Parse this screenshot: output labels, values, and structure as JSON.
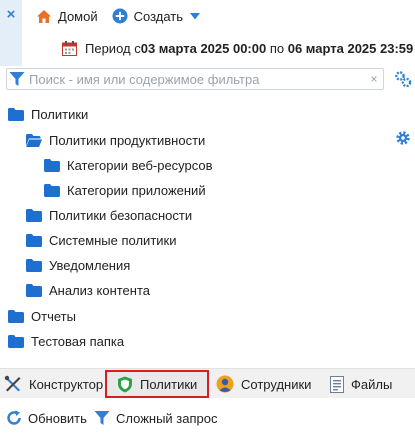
{
  "topbar": {
    "close_glyph": "×",
    "home_label": "Домой",
    "create_label": "Создать"
  },
  "period": {
    "prefix": "Период с ",
    "from": "03 марта 2025 00:00",
    "middle": " по ",
    "to": "06 марта 2025 23:59"
  },
  "filter": {
    "placeholder": "Поиск - имя или содержимое фильтра",
    "clear_glyph": "×"
  },
  "tree": {
    "items": [
      {
        "label": "Политики"
      },
      {
        "label": "Политики продуктивности"
      },
      {
        "label": "Категории веб-ресурсов"
      },
      {
        "label": "Категории приложений"
      },
      {
        "label": "Политики безопасности"
      },
      {
        "label": "Системные политики"
      },
      {
        "label": "Уведомления"
      },
      {
        "label": "Анализ контента"
      },
      {
        "label": "Отчеты"
      },
      {
        "label": "Тестовая папка"
      }
    ]
  },
  "bottom_tabs": [
    {
      "label": "Конструктор",
      "icon": "tools-icon"
    },
    {
      "label": "Политики",
      "icon": "shield-icon",
      "active": true
    },
    {
      "label": "Сотрудники",
      "icon": "user-icon"
    },
    {
      "label": "Файлы",
      "icon": "document-icon"
    }
  ],
  "actions": {
    "refresh_label": "Обновить",
    "query_label": "Сложный запрос"
  },
  "colors": {
    "folder": "#1f6fd1",
    "accent": "#2f7fd6",
    "active_border": "#d81e1e",
    "home": "#e8712a"
  }
}
